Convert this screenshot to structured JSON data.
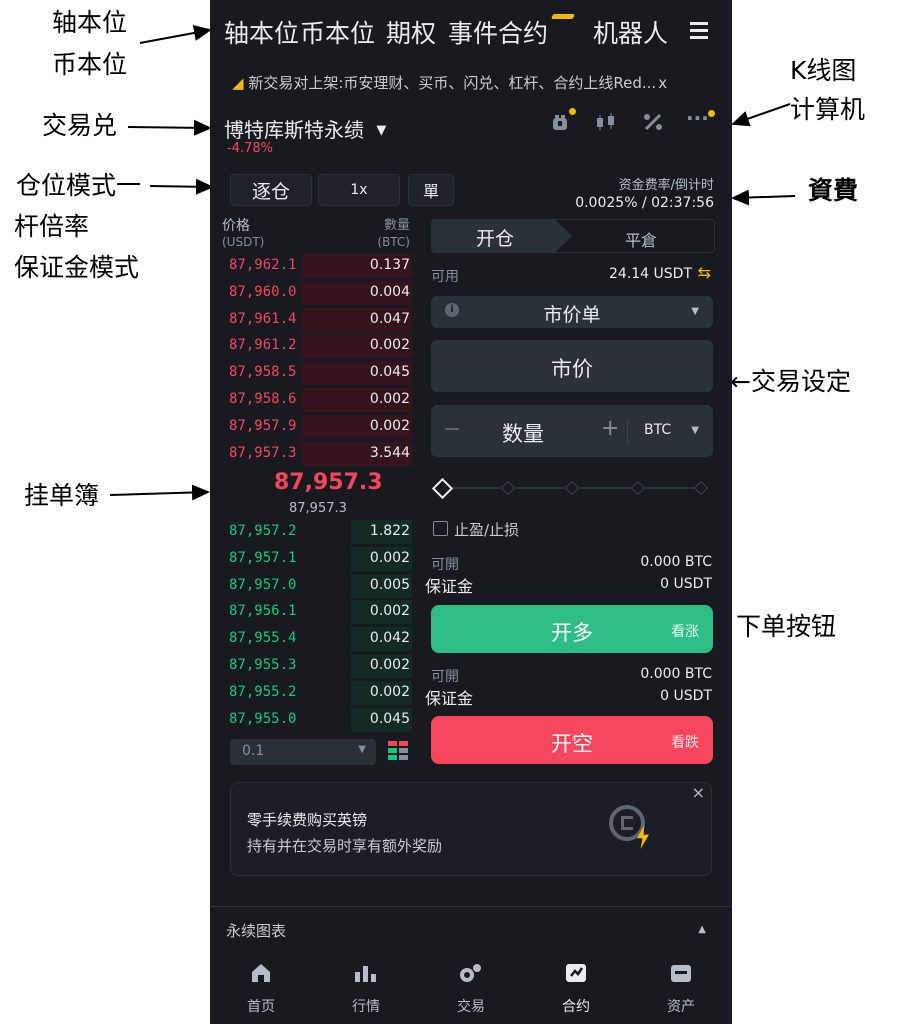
{
  "annotations": {
    "usdt_m": "轴本位",
    "coin_m": "币本位",
    "pair": "交易兑",
    "position_mode": "仓位模式一",
    "leverage": "杆倍率",
    "margin_mode": "保证金模式",
    "orderbook": "挂单簿",
    "kline": "K线图",
    "calculator": "计算机",
    "funding": "資費",
    "trade_settings": "←交易设定",
    "order_buttons": "下单按钮"
  },
  "top_nav": {
    "tabs": [
      "轴本位",
      "币本位",
      "期权",
      "事件合约"
    ],
    "bot_label": "机器人",
    "menu_icon": "hamburger-icon"
  },
  "announcement": {
    "icon": "megaphone-icon",
    "text": "新交易对上架:币安理财、买币、闪兑、杠杆、合约上线Red...",
    "close": "x"
  },
  "pair": {
    "name": "博特库斯特永绩",
    "change": "-4.78%"
  },
  "toolbar_icons": [
    "alarm-clock-icon",
    "candlestick-icon",
    "percent-calculator-icon",
    "more-icon"
  ],
  "controls": {
    "margin_mode": "逐仓",
    "leverage": "1x",
    "position_mode": "單"
  },
  "funding": {
    "label": "资金费率/倒计时",
    "value": "0.0025% / 02:37:56"
  },
  "orderbook": {
    "price_header": "价格",
    "price_unit": "(USDT)",
    "qty_header": "數量",
    "qty_unit": "(BTC)",
    "asks": [
      {
        "price": "87,962.1",
        "qty": "0.137",
        "depth": 0.55
      },
      {
        "price": "87,960.0",
        "qty": "0.004",
        "depth": 0.55
      },
      {
        "price": "87,961.4",
        "qty": "0.047",
        "depth": 0.55
      },
      {
        "price": "87,961.2",
        "qty": "0.002",
        "depth": 0.55
      },
      {
        "price": "87,958.5",
        "qty": "0.045",
        "depth": 0.55
      },
      {
        "price": "87,958.6",
        "qty": "0.002",
        "depth": 0.55
      },
      {
        "price": "87,957.9",
        "qty": "0.002",
        "depth": 0.55
      },
      {
        "price": "87,957.3",
        "qty": "3.544",
        "depth": 0.55
      }
    ],
    "last_price": "87,957.3",
    "mark_price": "87,957.3",
    "bids": [
      {
        "price": "87,957.2",
        "qty": "1.822",
        "depth": 0.3
      },
      {
        "price": "87,957.1",
        "qty": "0.002",
        "depth": 0.3
      },
      {
        "price": "87,957.0",
        "qty": "0.005",
        "depth": 0.3
      },
      {
        "price": "87,956.1",
        "qty": "0.002",
        "depth": 0.3
      },
      {
        "price": "87,955.4",
        "qty": "0.042",
        "depth": 0.3
      },
      {
        "price": "87,955.3",
        "qty": "0.002",
        "depth": 0.3
      },
      {
        "price": "87,955.2",
        "qty": "0.002",
        "depth": 0.3
      },
      {
        "price": "87,955.0",
        "qty": "0.045",
        "depth": 0.3
      }
    ],
    "tick_size": "0.1"
  },
  "order_form": {
    "tab_open": "开仓",
    "tab_close": "平倉",
    "available_label": "可用",
    "available_value": "24.14 USDT",
    "order_type": "市价单",
    "price_field": "市价",
    "qty_placeholder": "数量",
    "qty_minus": "−",
    "qty_plus": "+",
    "qty_unit": "BTC",
    "tpsl_label": "止盈/止损",
    "long_block": {
      "can_open_label": "可開",
      "can_open_value": "0.000 BTC",
      "margin_label": "保证金",
      "margin_value": "0 USDT"
    },
    "short_block": {
      "can_open_label": "可開",
      "can_open_value": "0.000 BTC",
      "margin_label": "保证金",
      "margin_value": "0 USDT"
    },
    "long_button": "开多",
    "long_sub": "看涨",
    "short_button": "开空",
    "short_sub": "看跌"
  },
  "promo": {
    "title": "零手续费购买英镑",
    "subtitle": "持有并在交易时享有额外奖励",
    "close": "×"
  },
  "chart_bar": {
    "label": "永续图表",
    "toggle": "▲"
  },
  "bottom_nav": [
    {
      "label": "首页",
      "icon": "home-icon"
    },
    {
      "label": "行情",
      "icon": "markets-icon"
    },
    {
      "label": "交易",
      "icon": "trade-icon"
    },
    {
      "label": "合约",
      "icon": "futures-icon"
    },
    {
      "label": "资产",
      "icon": "wallet-icon"
    }
  ],
  "colors": {
    "bg": "#181a20",
    "red": "#f6465d",
    "green": "#0ecb81",
    "yellow": "#f0b90b"
  }
}
